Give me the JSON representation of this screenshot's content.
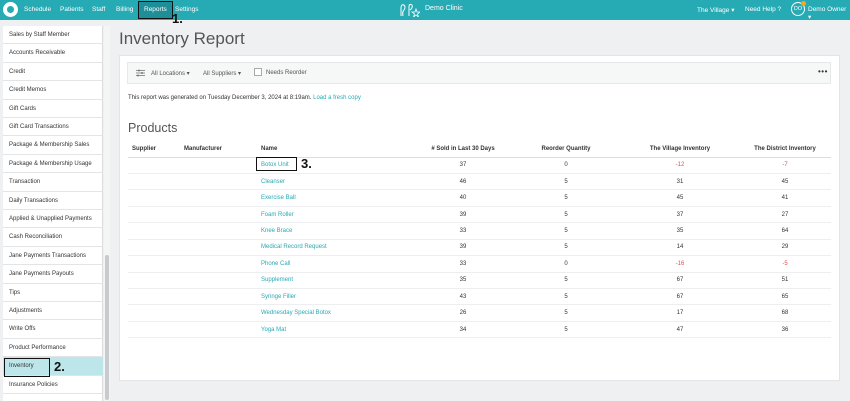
{
  "nav": {
    "items": [
      "Schedule",
      "Patients",
      "Staff",
      "Billing",
      "Reports",
      "Settings"
    ],
    "clinic_name": "Demo Clinic",
    "location": "The Village ▾",
    "help": "Need Help ?",
    "avatar_initials": "DO",
    "user": "Demo Owner ▾"
  },
  "callouts": {
    "one": "1.",
    "two": "2.",
    "three": "3."
  },
  "sidebar": {
    "items": [
      "Sales by Staff Member",
      "Accounts Receivable",
      "Credit",
      "Credit Memos",
      "Gift Cards",
      "Gift Card Transactions",
      "Package & Membership Sales",
      "Package & Membership Usage",
      "Transaction",
      "Daily Transactions",
      "Applied & Unapplied Payments",
      "Cash Reconciliation",
      "Jane Payments Transactions",
      "Jane Payments Payouts",
      "Tips",
      "Adjustments",
      "Write Offs",
      "Product Performance",
      "Inventory",
      "Insurance Policies"
    ],
    "active": "Inventory"
  },
  "page": {
    "title": "Inventory Report",
    "filters": {
      "locations": "All Locations ▾",
      "suppliers": "All Suppliers ▾",
      "needs_reorder": "Needs Reorder",
      "more": "•••"
    },
    "generated": "This report was generated on Tuesday December 3, 2024 at 8:19am.",
    "refresh": "Load a fresh copy",
    "section": "Products"
  },
  "table": {
    "headers": [
      "Supplier",
      "Manufacturer",
      "Name",
      "# Sold in Last 30 Days",
      "Reorder Quantity",
      "The Village Inventory",
      "The District Inventory"
    ],
    "rows": [
      [
        "",
        "",
        "Botox Unit",
        "37",
        "0",
        "-12",
        "-7"
      ],
      [
        "",
        "",
        "Cleanser",
        "46",
        "5",
        "31",
        "45"
      ],
      [
        "",
        "",
        "Exercise Ball",
        "40",
        "5",
        "45",
        "41"
      ],
      [
        "",
        "",
        "Foam Roller",
        "39",
        "5",
        "37",
        "27"
      ],
      [
        "",
        "",
        "Knee Brace",
        "33",
        "5",
        "35",
        "64"
      ],
      [
        "",
        "",
        "Medical Record Request",
        "39",
        "5",
        "14",
        "29"
      ],
      [
        "",
        "",
        "Phone Call",
        "33",
        "0",
        "-16",
        "-5"
      ],
      [
        "",
        "",
        "Supplement",
        "35",
        "5",
        "67",
        "51"
      ],
      [
        "",
        "",
        "Syringe Filler",
        "43",
        "5",
        "67",
        "65"
      ],
      [
        "",
        "",
        "Wednesday Special Botox",
        "26",
        "5",
        "17",
        "68"
      ],
      [
        "",
        "",
        "Yoga Mat",
        "34",
        "5",
        "47",
        "36"
      ]
    ]
  },
  "colors": {
    "accent": "#26aab4",
    "negative": "#d9534f",
    "active_row": "#bde6ea"
  }
}
